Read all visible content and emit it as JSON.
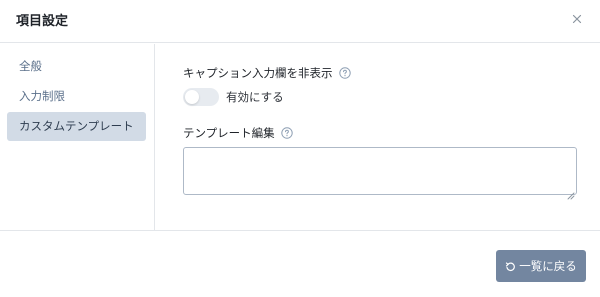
{
  "dialog": {
    "title": "項目設定"
  },
  "sidebar": {
    "items": [
      {
        "label": "全般",
        "active": false
      },
      {
        "label": "入力制限",
        "active": false
      },
      {
        "label": "カスタムテンプレート",
        "active": true
      }
    ]
  },
  "main": {
    "hide_caption_label": "キャプション入力欄を非表示",
    "toggle_label": "有効にする",
    "toggle_on": false,
    "template_edit_label": "テンプレート編集",
    "template_value": ""
  },
  "footer": {
    "back_button_label": "一覧に戻る"
  },
  "icons": {
    "close": "close-icon",
    "help": "question-circle-icon",
    "back": "undo-icon"
  },
  "colors": {
    "accent_button": "#7386a0",
    "active_sidebar": "#d2dbe6",
    "sidebar_text": "#5a6f8a"
  }
}
